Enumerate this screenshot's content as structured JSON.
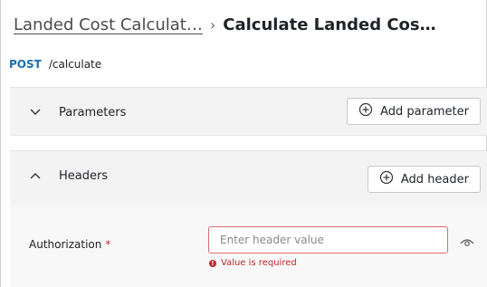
{
  "breadcrumb": {
    "parent": "Landed Cost Calculat…",
    "separator": "›",
    "current": "Calculate Landed Cos…"
  },
  "endpoint": {
    "method": "POST",
    "path": "/calculate"
  },
  "parameters": {
    "title": "Parameters",
    "expanded": false,
    "add_label": "Add parameter"
  },
  "headers": {
    "title": "Headers",
    "expanded": true,
    "add_label": "Add header",
    "authorization": {
      "label": "Authorization",
      "required_mark": "*",
      "value": "",
      "placeholder": "Enter header value",
      "error": "Value is required"
    }
  },
  "colors": {
    "method": "#1a6fb3",
    "error": "#c0272d",
    "section_bg": "#f3f3f3"
  }
}
